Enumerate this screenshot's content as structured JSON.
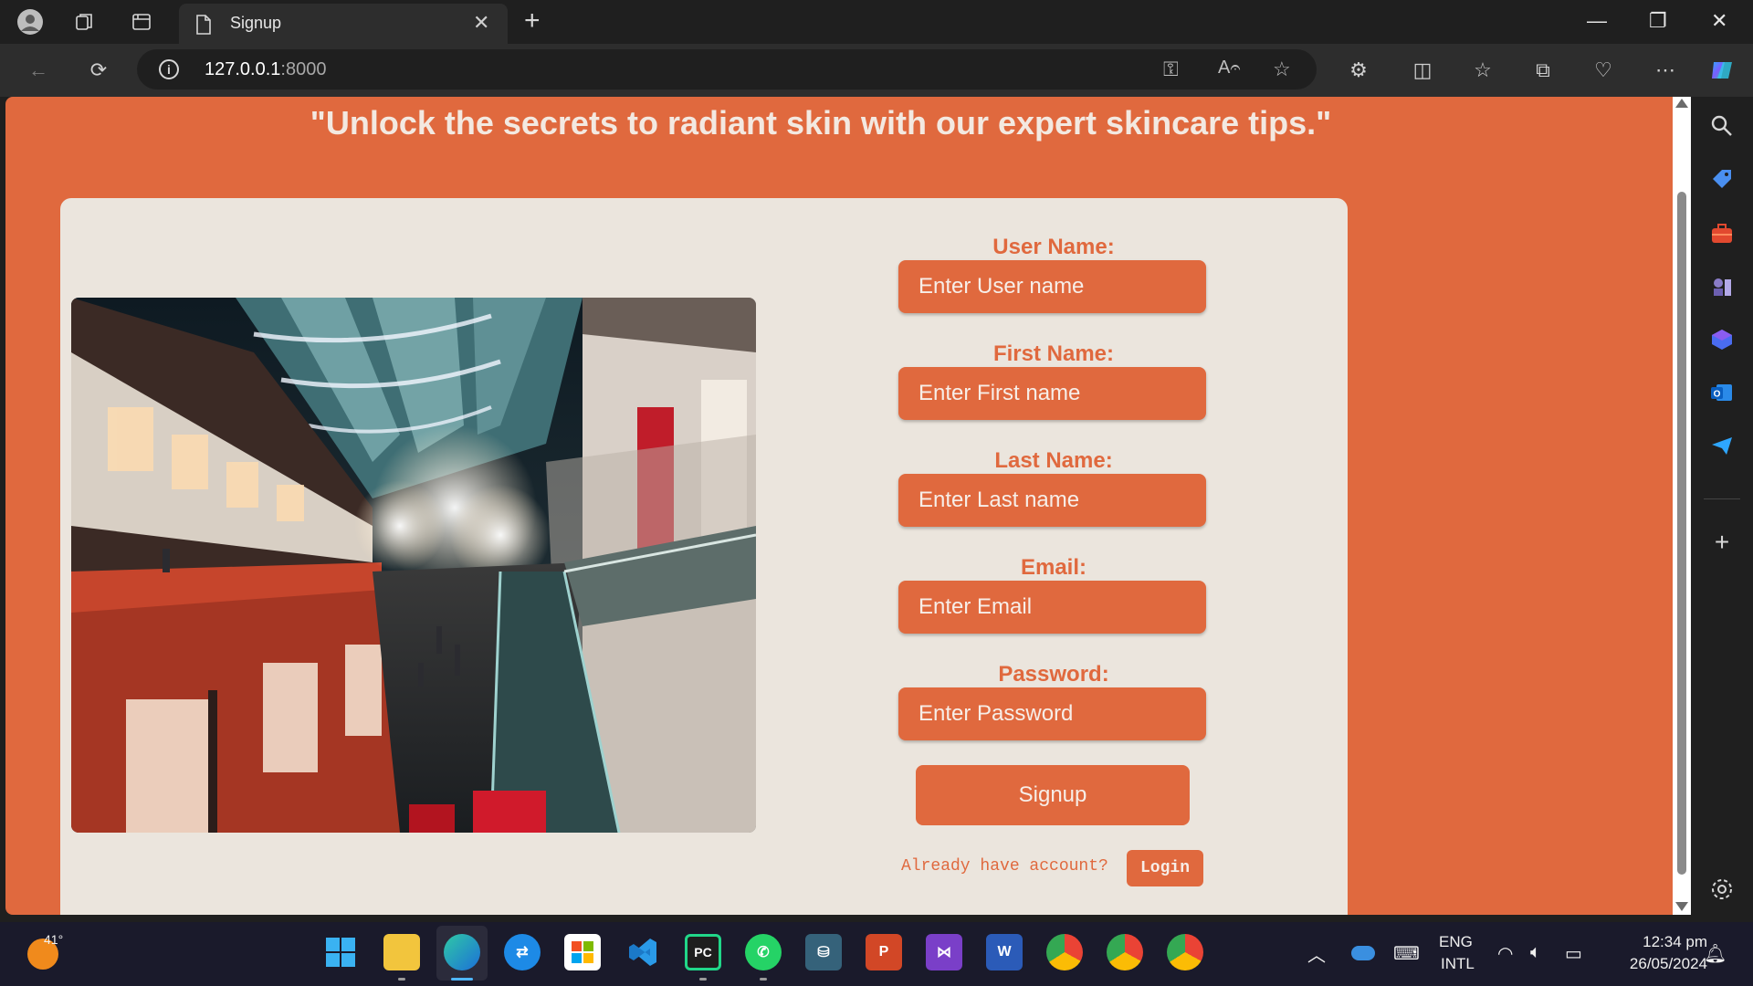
{
  "browser": {
    "tab_title": "Signup",
    "url_host": "127.0.0.1",
    "url_port": ":8000"
  },
  "page": {
    "headline": "\"Unlock the secrets to radiant skin with our expert skincare tips.\"",
    "form": {
      "username_label": "User Name:",
      "username_placeholder": "Enter User name",
      "firstname_label": "First Name:",
      "firstname_placeholder": "Enter First name",
      "lastname_label": "Last Name:",
      "lastname_placeholder": "Enter Last name",
      "email_label": "Email:",
      "email_placeholder": "Enter Email",
      "password_label": "Password:",
      "password_placeholder": "Enter Password",
      "signup_button": "Signup",
      "already_text": "Already have account?",
      "login_button": "Login"
    }
  },
  "taskbar": {
    "weather_temp": "41°",
    "language_top": "ENG",
    "language_bottom": "INTL",
    "time": "12:34 pm",
    "date": "26/05/2024"
  },
  "colors": {
    "accent": "#e0693e",
    "card_bg": "#ebe5dd",
    "headline_text": "#f3e9e1"
  }
}
